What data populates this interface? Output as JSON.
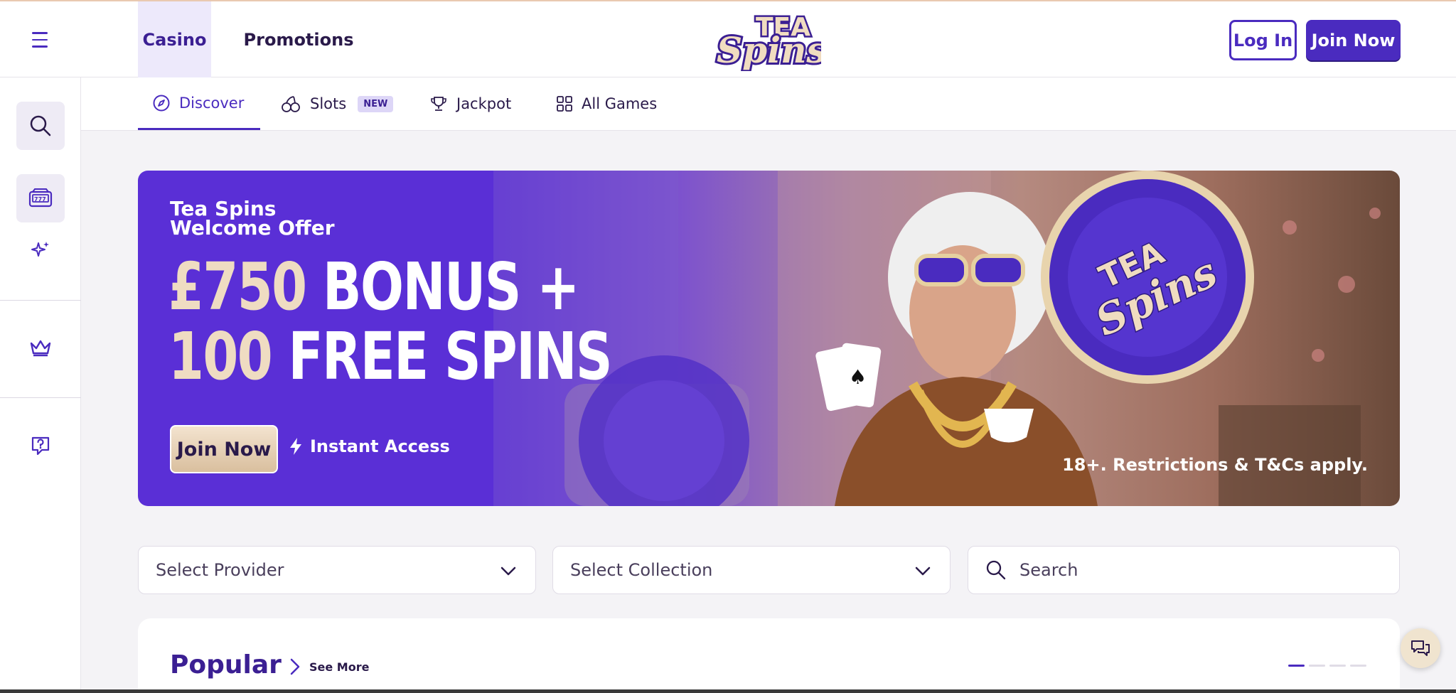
{
  "header": {
    "tabs": [
      {
        "label": "Casino",
        "active": true
      },
      {
        "label": "Promotions",
        "active": false
      }
    ],
    "logo": {
      "line1": "TEA",
      "line2": "Spins"
    },
    "login_label": "Log In",
    "join_label": "Join Now"
  },
  "subnav": {
    "tabs": [
      {
        "label": "Discover",
        "icon": "compass-icon",
        "active": true
      },
      {
        "label": "Slots",
        "icon": "cherries-icon",
        "badge": "NEW"
      },
      {
        "label": "Jackpot",
        "icon": "trophy-icon"
      },
      {
        "label": "All Games",
        "icon": "grid-icon"
      }
    ]
  },
  "sidebar": {
    "icons": [
      "search-icon",
      "slot-machine-icon",
      "sparkles-icon",
      "crown-icon",
      "help-icon"
    ]
  },
  "banner": {
    "title_line1": "Tea Spins",
    "title_line2": "Welcome Offer",
    "amount_gold": "£750",
    "amount_rest": " BONUS +",
    "amount_gold2": "100",
    "amount_rest2": " FREE SPINS",
    "join_label": "Join Now",
    "instant_label": "Instant Access",
    "terms": "18+. Restrictions & T&Cs apply."
  },
  "filters": {
    "provider_label": "Select Provider",
    "collection_label": "Select Collection",
    "search_placeholder": "Search"
  },
  "popular": {
    "title": "Popular",
    "see_more": "See More",
    "pages": 4,
    "current_page": 1
  },
  "colors": {
    "brand": "#4a2bbf",
    "gold": "#efdcc2",
    "background": "#f4f3f6"
  }
}
